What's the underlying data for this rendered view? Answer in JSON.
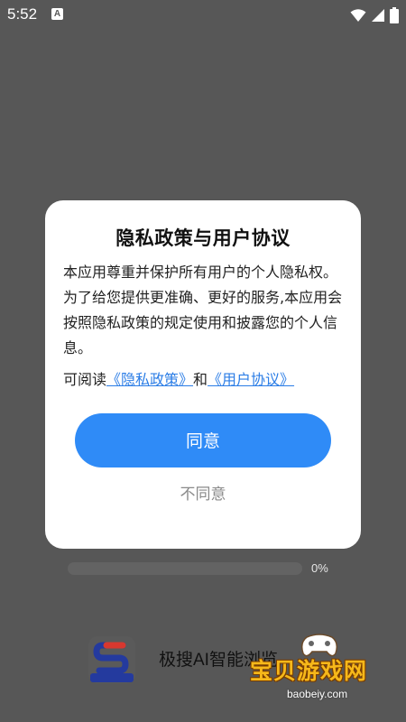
{
  "status_bar": {
    "time": "5:52",
    "notification_icon": "a-icon",
    "icons": [
      "wifi-icon",
      "signal-icon",
      "battery-icon"
    ]
  },
  "dialog": {
    "title": "隐私政策与用户协议",
    "body": "本应用尊重并保护所有用户的个人隐私权。为了给您提供更准确、更好的服务,本应用会按照隐私政策的规定使用和披露您的个人信息。",
    "read_prefix": "可阅读",
    "privacy_link": "《隐私政策》",
    "and_text": "和",
    "agreement_link": "《用户协议》",
    "agree_label": "同意",
    "disagree_label": "不同意"
  },
  "progress": {
    "value": 0,
    "text": "0%"
  },
  "app": {
    "name": "极搜AI智能浏览",
    "logo_icon": "app-logo-icon"
  },
  "watermark": {
    "title": "宝贝游戏网",
    "domain": "baobeiy.com"
  },
  "colors": {
    "accent": "#2f8bf7",
    "link": "#2b7de6",
    "overlay": "#575757"
  }
}
